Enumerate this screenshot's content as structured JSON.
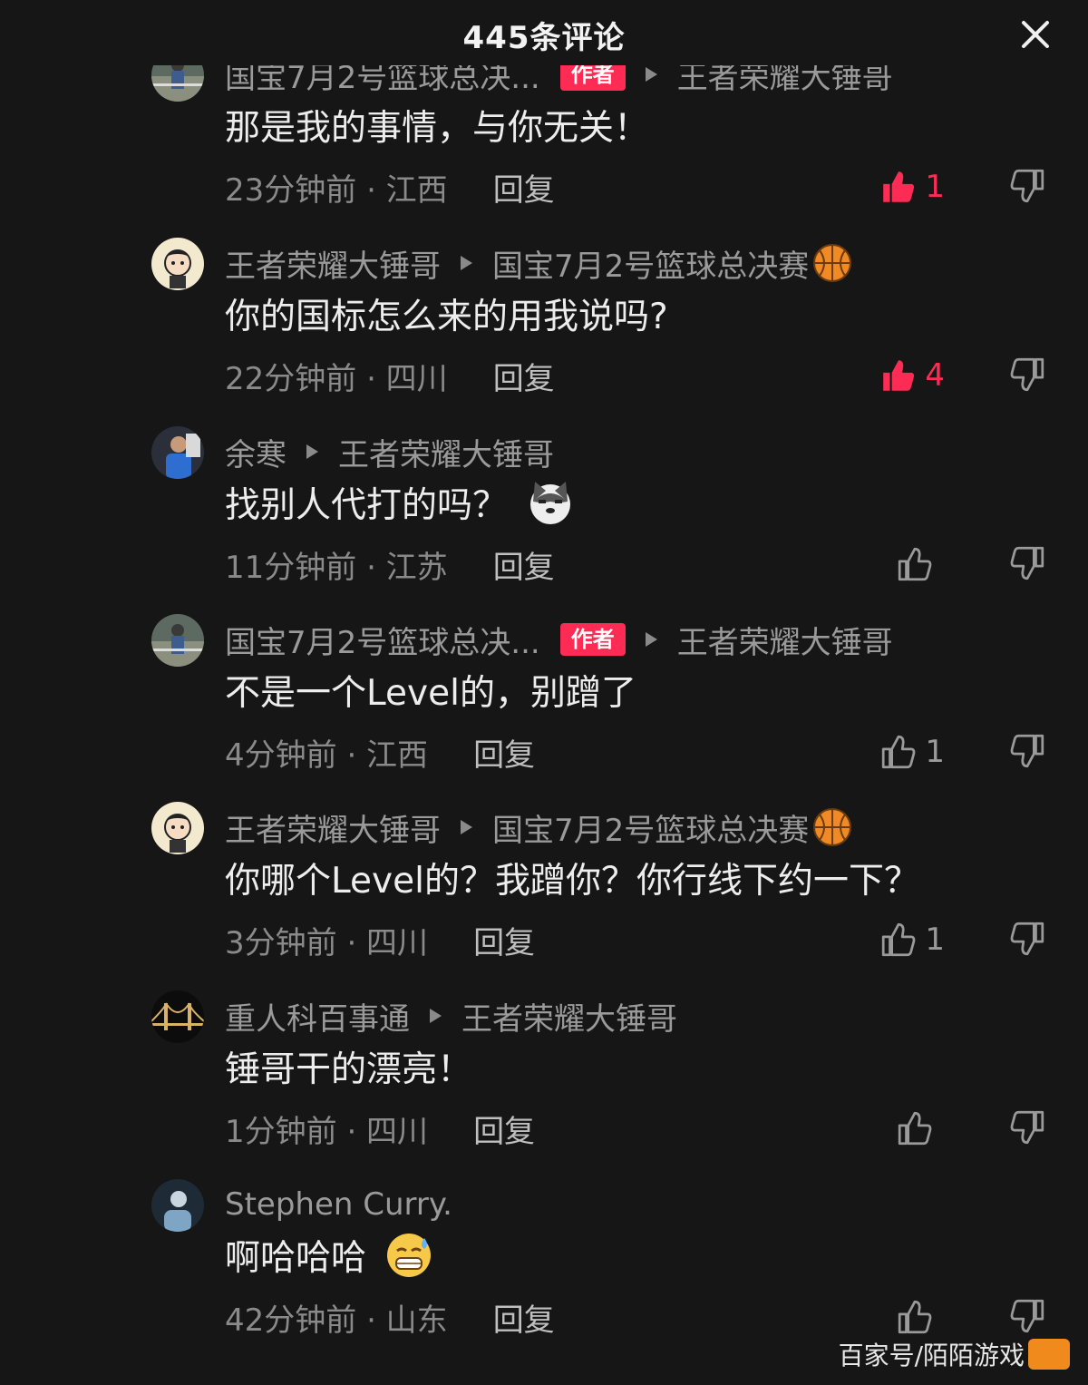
{
  "header": {
    "title": "445条评论",
    "close_icon": "close-icon"
  },
  "colors": {
    "background": "#161616",
    "accent": "#fe2c55",
    "meta": "#9a9a9a"
  },
  "comments": [
    {
      "avatar": "avatar-person-outdoor",
      "user": "国宝7月2号篮球总决...",
      "author_badge": "作者",
      "reply_to": "王者荣耀大锤哥",
      "ball": false,
      "text": "那是我的事情，与你无关！",
      "emoji": "",
      "time": "23分钟前 · 江西",
      "reply": "回复",
      "likes": "1",
      "liked": true
    },
    {
      "avatar": "avatar-cartoon",
      "user": "王者荣耀大锤哥",
      "author_badge": "",
      "reply_to": "国宝7月2号篮球总决赛",
      "ball": true,
      "text": "你的国标怎么来的用我说吗?",
      "emoji": "",
      "time": "22分钟前 · 四川",
      "reply": "回复",
      "likes": "4",
      "liked": true
    },
    {
      "avatar": "avatar-person-blue",
      "user": "余寒",
      "author_badge": "",
      "reply_to": "王者荣耀大锤哥",
      "ball": false,
      "text": "找别人代打的吗？",
      "emoji": "husky-emoji",
      "time": "11分钟前 · 江苏",
      "reply": "回复",
      "likes": "",
      "liked": false
    },
    {
      "avatar": "avatar-person-outdoor",
      "user": "国宝7月2号篮球总决...",
      "author_badge": "作者",
      "reply_to": "王者荣耀大锤哥",
      "ball": false,
      "text": "不是一个Level的，别蹭了",
      "emoji": "",
      "time": "4分钟前 · 江西",
      "reply": "回复",
      "likes": "1",
      "liked": false
    },
    {
      "avatar": "avatar-cartoon",
      "user": "王者荣耀大锤哥",
      "author_badge": "",
      "reply_to": "国宝7月2号篮球总决赛",
      "ball": true,
      "text": "你哪个Level的？我蹭你？你行线下约一下？",
      "emoji": "",
      "time": "3分钟前 · 四川",
      "reply": "回复",
      "likes": "1",
      "liked": false
    },
    {
      "avatar": "avatar-bridge",
      "user": "重人科百事通",
      "author_badge": "",
      "reply_to": "王者荣耀大锤哥",
      "ball": false,
      "text": "锤哥干的漂亮！",
      "emoji": "",
      "time": "1分钟前 · 四川",
      "reply": "回复",
      "likes": "",
      "liked": false
    },
    {
      "avatar": "avatar-dark-person",
      "user": "Stephen  Curry.",
      "author_badge": "",
      "reply_to": "",
      "ball": false,
      "text": "啊哈哈哈",
      "emoji": "grin-sweat-emoji",
      "time": "42分钟前 · 山东",
      "reply": "回复",
      "likes": "",
      "liked": false
    }
  ],
  "watermark": {
    "text": "百家号/陌陌游戏"
  }
}
